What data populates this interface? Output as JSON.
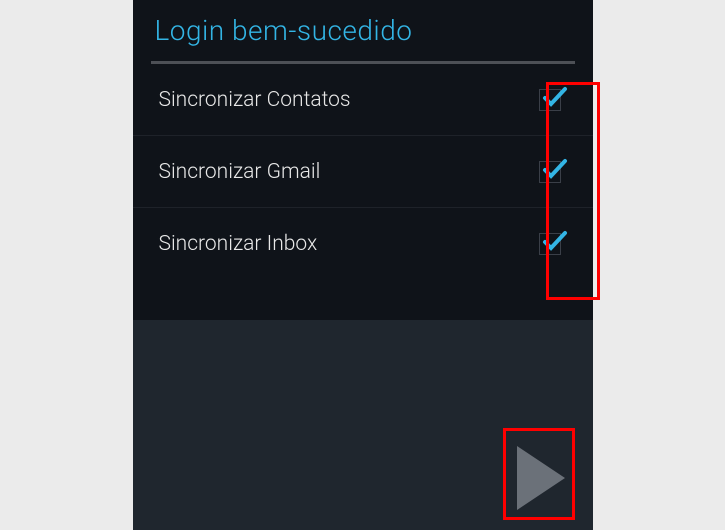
{
  "header": {
    "title": "Login bem-sucedido"
  },
  "items": [
    {
      "label": "Sincronizar Contatos",
      "checked": true
    },
    {
      "label": "Sincronizar Gmail",
      "checked": true
    },
    {
      "label": "Sincronizar Inbox",
      "checked": true
    }
  ],
  "colors": {
    "accent": "#33b5e5",
    "highlight": "#ff0000"
  }
}
